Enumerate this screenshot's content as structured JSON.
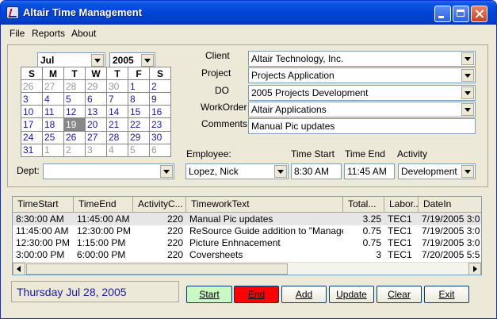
{
  "window": {
    "title": "Altair Time Management"
  },
  "menu": [
    "File",
    "Reports",
    "About"
  ],
  "calendar": {
    "month": "Jul",
    "year": "2005",
    "weekdays": [
      "S",
      "M",
      "T",
      "W",
      "T",
      "F",
      "S"
    ],
    "weeks": [
      [
        "26",
        "27",
        "28",
        "29",
        "30",
        "1",
        "2"
      ],
      [
        "3",
        "4",
        "5",
        "6",
        "7",
        "8",
        "9"
      ],
      [
        "10",
        "11",
        "12",
        "13",
        "14",
        "15",
        "16"
      ],
      [
        "17",
        "18",
        "19",
        "20",
        "21",
        "22",
        "23"
      ],
      [
        "24",
        "25",
        "26",
        "27",
        "28",
        "29",
        "30"
      ],
      [
        "31",
        "1",
        "2",
        "3",
        "4",
        "5",
        "6"
      ]
    ],
    "selected_day": "19"
  },
  "form": {
    "client_label": "Client",
    "client_value": "Altair Technology, Inc.",
    "project_label": "Project",
    "project_value": "Projects Application",
    "do_label": "DO",
    "do_value": "2005 Projects Development",
    "workorder_label": "WorkOrder",
    "workorder_value": "Altair Applications",
    "comments_label": "Comments",
    "comments_value": "Manual Pic updates",
    "dept_label": "Dept:",
    "dept_value": "",
    "employee_label": "Employee:",
    "employee_value": "Lopez, Nick",
    "timestart_label": "Time Start",
    "timestart_value": "8:30 AM",
    "timeend_label": "Time End",
    "timeend_value": "11:45 AM",
    "activity_label": "Activity",
    "activity_value": "Development"
  },
  "grid": {
    "columns": [
      "TimeStart",
      "TimeEnd",
      "ActivityC...",
      "TimeworkText",
      "Total...",
      "Labor...",
      "DateIn"
    ],
    "rows": [
      [
        "8:30:00 AM",
        "11:45:00 AM",
        "220",
        "Manual Pic updates",
        "3.25",
        "TEC1",
        "7/19/2005 3:0"
      ],
      [
        "11:45:00 AM",
        "12:30:00 PM",
        "220",
        "ReSource Guide addition to \"Manage...",
        "0.75",
        "TEC1",
        "7/19/2005 3:0"
      ],
      [
        "12:30:00 PM",
        "1:15:00 PM",
        "220",
        "Picture Enhnacement",
        "0.75",
        "TEC1",
        "7/19/2005 3:0"
      ],
      [
        "3:00:00 PM",
        "6:00:00 PM",
        "220",
        "Coversheets",
        "3",
        "TEC1",
        "7/20/2005 5:5"
      ]
    ]
  },
  "status": {
    "date": "Thursday Jul 28, 2005"
  },
  "buttons": {
    "start": "Start",
    "end": "End",
    "add": "Add",
    "update": "Update",
    "clear": "Clear",
    "exit": "Exit"
  },
  "colors": {
    "start_button": "#c9f7c6",
    "end_button": "#ff0000",
    "titlebar": "#0044d6",
    "date_text": "#1a1a9e"
  }
}
